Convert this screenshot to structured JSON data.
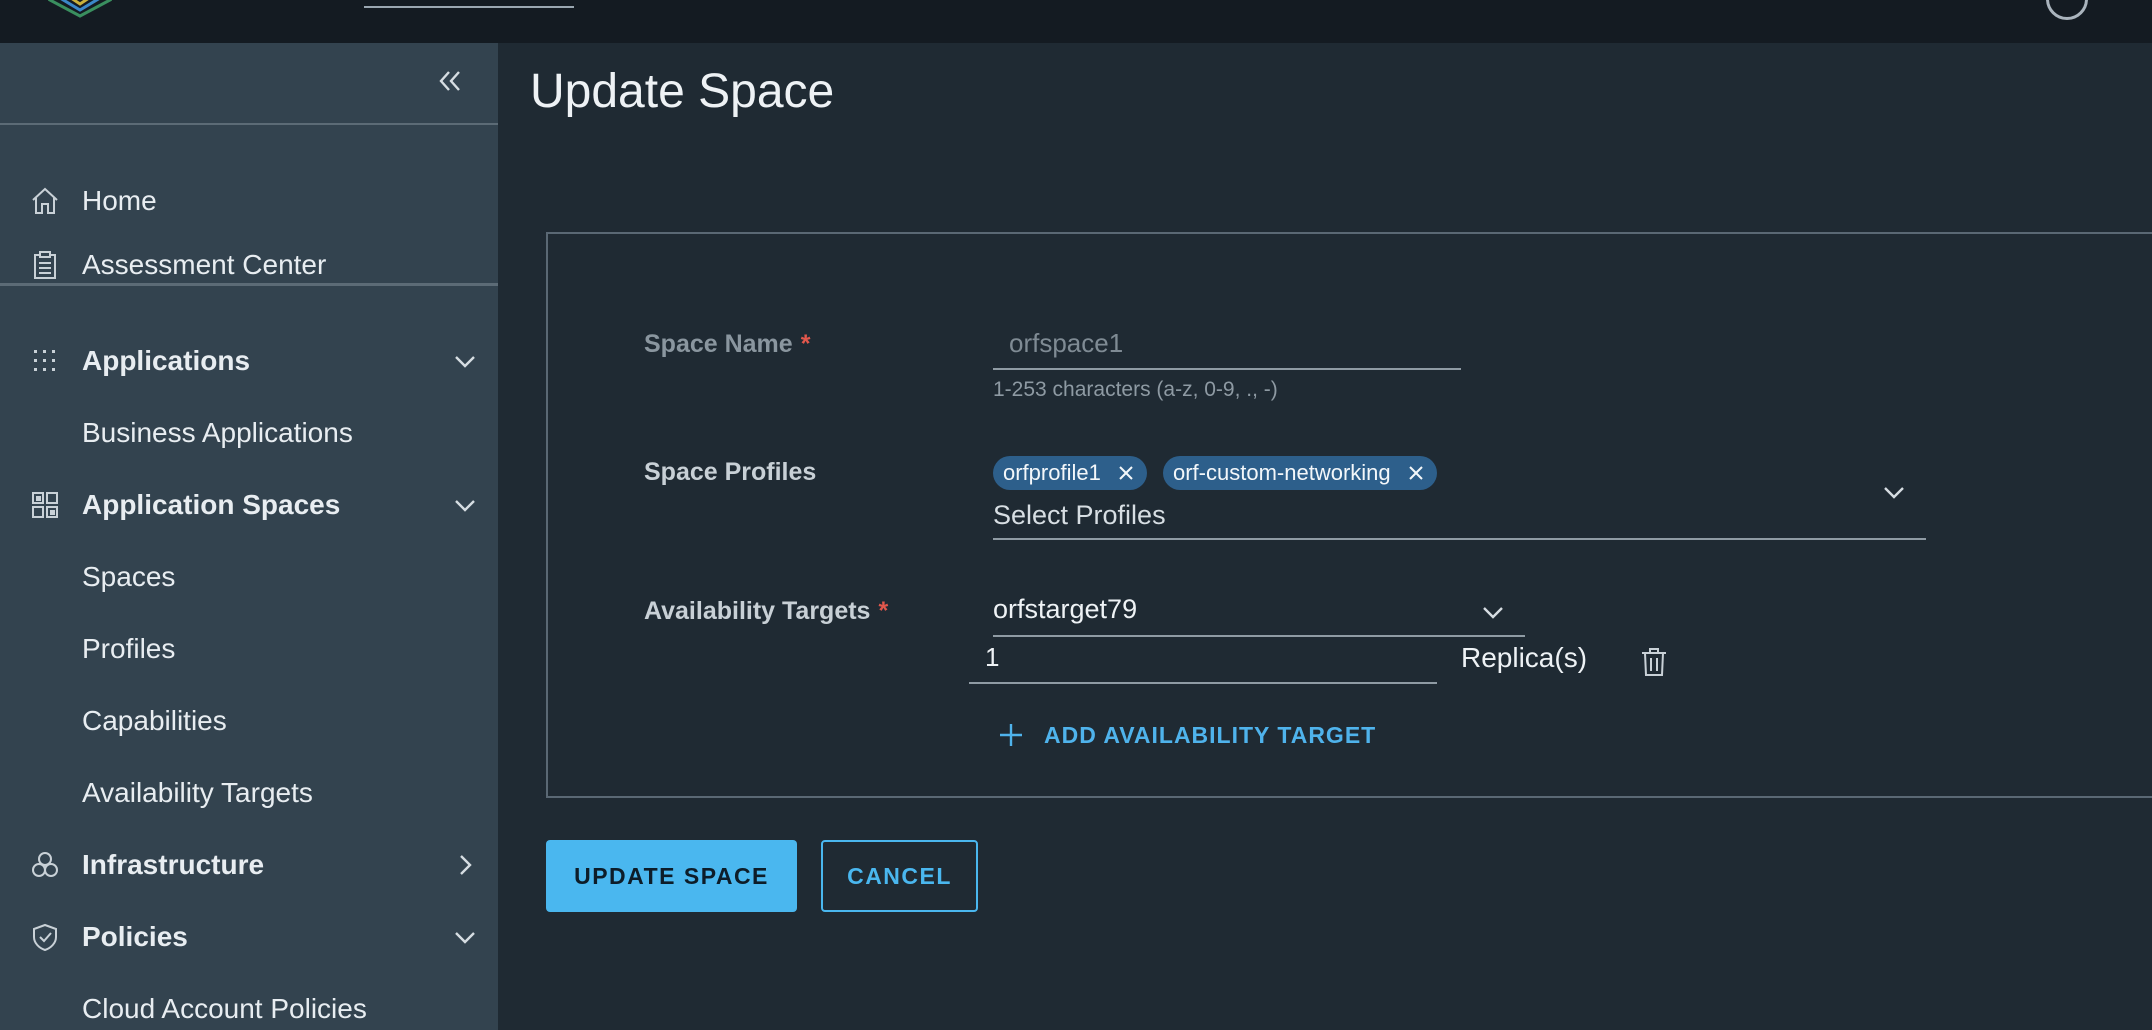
{
  "header": {
    "logo_icon": "hexagon-logo-icon",
    "help_icon": "help-circle-icon"
  },
  "sidebar": {
    "collapse_icon": "double-chevron-left-icon",
    "items": [
      {
        "label": "Home",
        "icon": "home-icon"
      },
      {
        "label": "Assessment Center",
        "icon": "clipboard-icon"
      },
      {
        "label": "Applications",
        "icon": "grid-dots-icon",
        "expanded": true
      },
      {
        "label": "Business Applications"
      },
      {
        "label": "Application Spaces",
        "icon": "grid-squares-icon",
        "expanded": true
      },
      {
        "label": "Spaces"
      },
      {
        "label": "Profiles"
      },
      {
        "label": "Capabilities"
      },
      {
        "label": "Availability Targets"
      },
      {
        "label": "Infrastructure",
        "icon": "hexagons-icon",
        "expanded": false
      },
      {
        "label": "Policies",
        "icon": "shield-check-icon",
        "expanded": true
      },
      {
        "label": "Cloud Account Policies"
      }
    ]
  },
  "main": {
    "title": "Update Space",
    "form": {
      "space_name": {
        "label": "Space Name",
        "required_mark": "*",
        "value": "orfspace1",
        "helper": "1-253 characters (a-z, 0-9, ., -)"
      },
      "space_profiles": {
        "label": "Space Profiles",
        "chips": [
          "orfprofile1",
          "orf-custom-networking"
        ],
        "placeholder": "Select Profiles"
      },
      "availability_targets": {
        "label": "Availability Targets",
        "required_mark": "*",
        "selected": "orfstarget79",
        "replicas": "1",
        "replicas_label": "Replica(s)",
        "add_label": "ADD AVAILABILITY TARGET"
      }
    },
    "buttons": {
      "update": "UPDATE SPACE",
      "cancel": "CANCEL"
    }
  },
  "colors": {
    "accent": "#4ab7ef",
    "chip_bg": "#2d5f8b",
    "required": "#e2574c",
    "sidebar_bg": "#33434f",
    "main_bg": "#1f2a33"
  }
}
